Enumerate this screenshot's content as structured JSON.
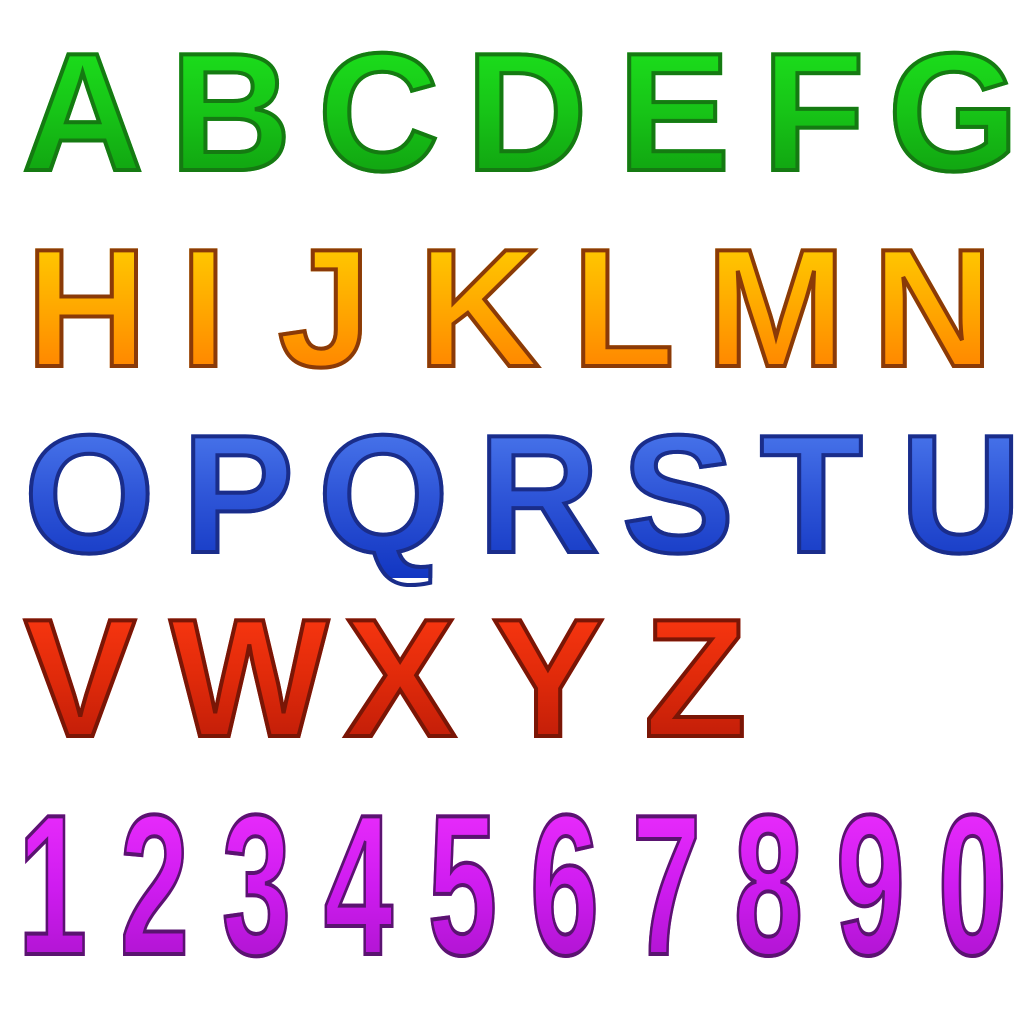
{
  "rows": [
    {
      "name": "row-letters-a-g",
      "color": "#17c417",
      "glyphs": [
        "A",
        "B",
        "C",
        "D",
        "E",
        "F",
        "G"
      ]
    },
    {
      "name": "row-letters-h-n",
      "color": "#ffa800",
      "glyphs": [
        "H",
        "I",
        "J",
        "K",
        "L",
        "M",
        "N"
      ]
    },
    {
      "name": "row-letters-o-u",
      "color": "#2f56d8",
      "glyphs": [
        "O",
        "P",
        "Q",
        "R",
        "S",
        "T",
        "U"
      ]
    },
    {
      "name": "row-letters-v-z",
      "color": "#e02a0a",
      "glyphs": [
        "V",
        "W",
        "X",
        "Y",
        "Z"
      ]
    },
    {
      "name": "row-digits",
      "color": "#cf1cf0",
      "glyphs": [
        "1",
        "2",
        "3",
        "4",
        "5",
        "6",
        "7",
        "8",
        "9",
        "0"
      ]
    }
  ]
}
